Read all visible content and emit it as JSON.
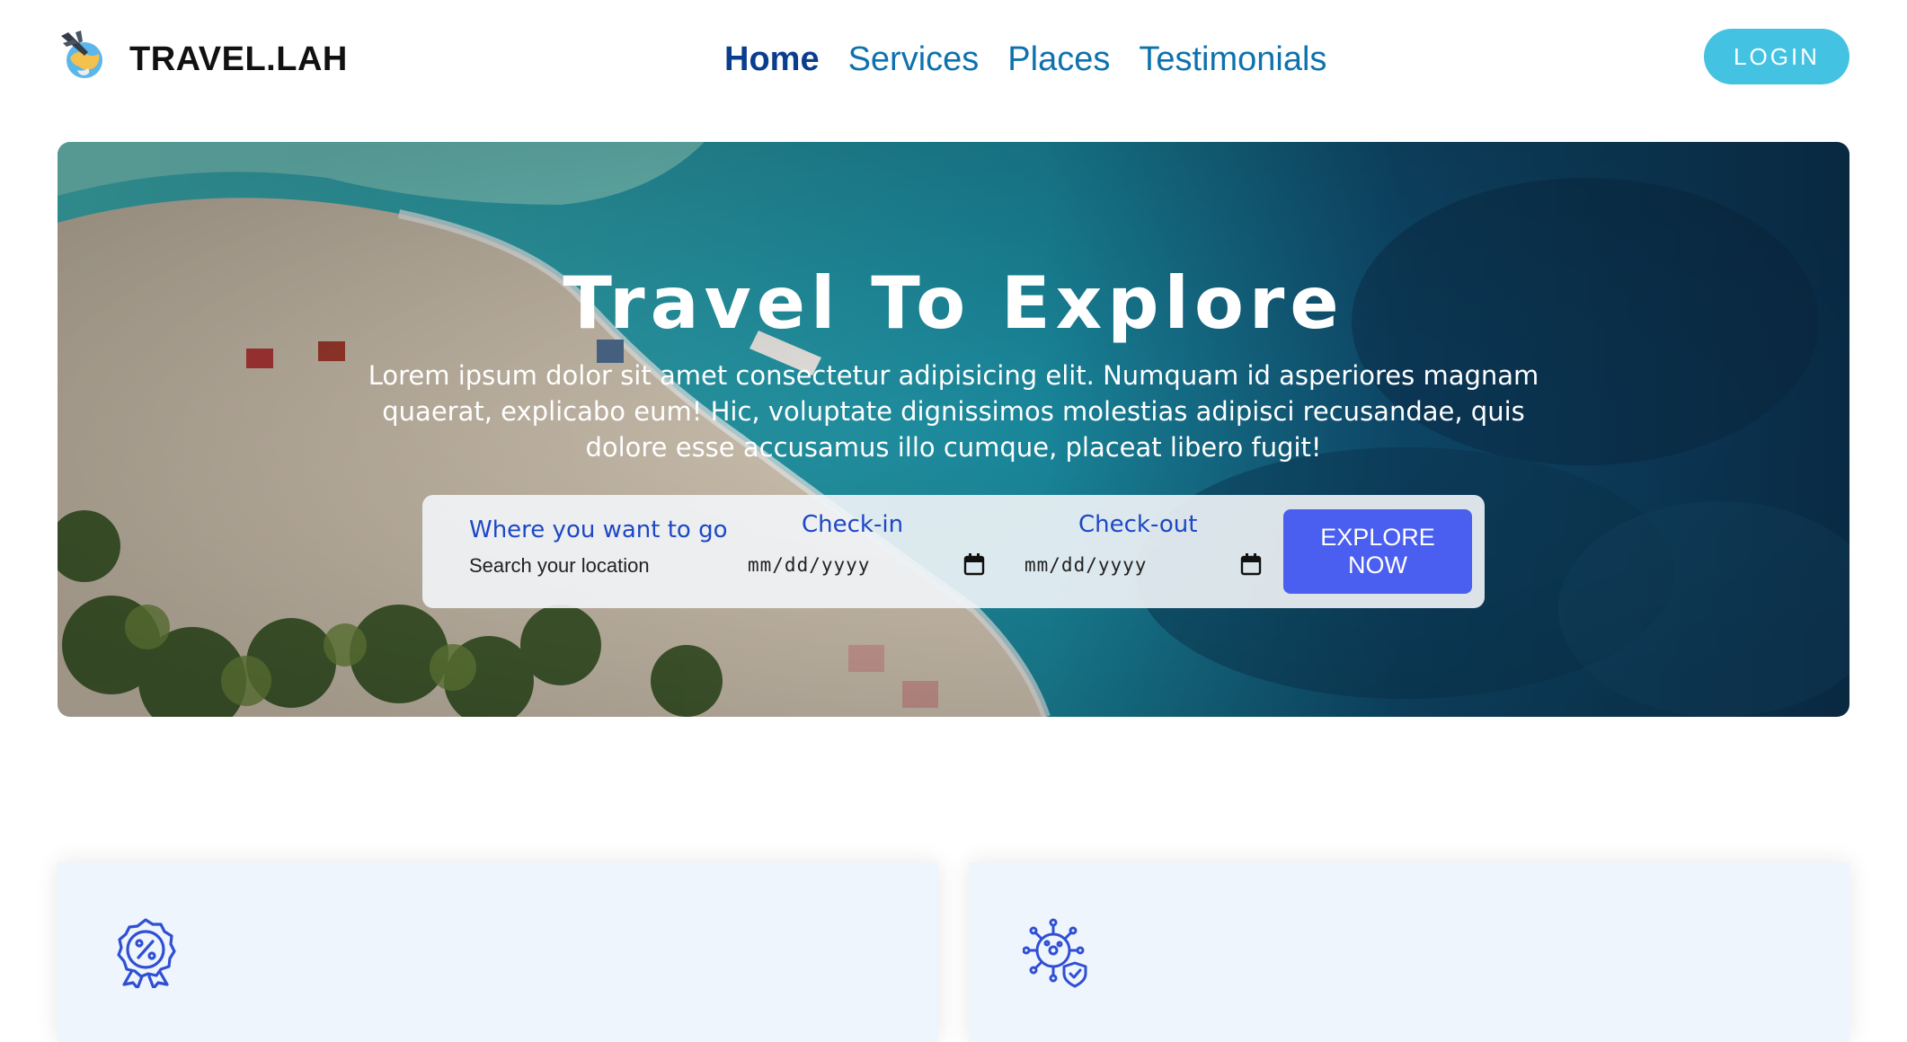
{
  "brand": {
    "name": "TRAVEL.LAH",
    "logo_icon": "globe-plane-icon"
  },
  "nav": {
    "items": [
      {
        "label": "Home",
        "active": true
      },
      {
        "label": "Services",
        "active": false
      },
      {
        "label": "Places",
        "active": false
      },
      {
        "label": "Testimonials",
        "active": false
      }
    ],
    "login_label": "LOGIN"
  },
  "hero": {
    "title": "Travel To Explore",
    "text": "Lorem ipsum dolor sit amet consectetur adipisicing elit. Numquam id asperiores magnam quaerat, explicabo eum! Hic, voluptate dignissimos molestias adipisci recusandae, quis dolore esse accusamus illo cumque, placeat libero fugit!",
    "background": "aerial-beach-image"
  },
  "search": {
    "location_label": "Where you want to go",
    "location_placeholder": "Search your location",
    "checkin_label": "Check-in",
    "checkin_value": "mm/dd/yyyy",
    "checkout_label": "Check-out",
    "checkout_value": "mm/dd/yyyy",
    "calendar_icon": "calendar-icon",
    "button_label": "EXPLORE NOW"
  },
  "features": [
    {
      "icon": "discount-badge-icon"
    },
    {
      "icon": "virus-shield-icon"
    }
  ],
  "colors": {
    "nav_link": "#0d72ae",
    "nav_active": "#0b3d8f",
    "login_bg": "#44c2e2",
    "search_label": "#1d47c7",
    "explore_bg": "#4a5ff0",
    "card_bg": "#eff5fd"
  }
}
